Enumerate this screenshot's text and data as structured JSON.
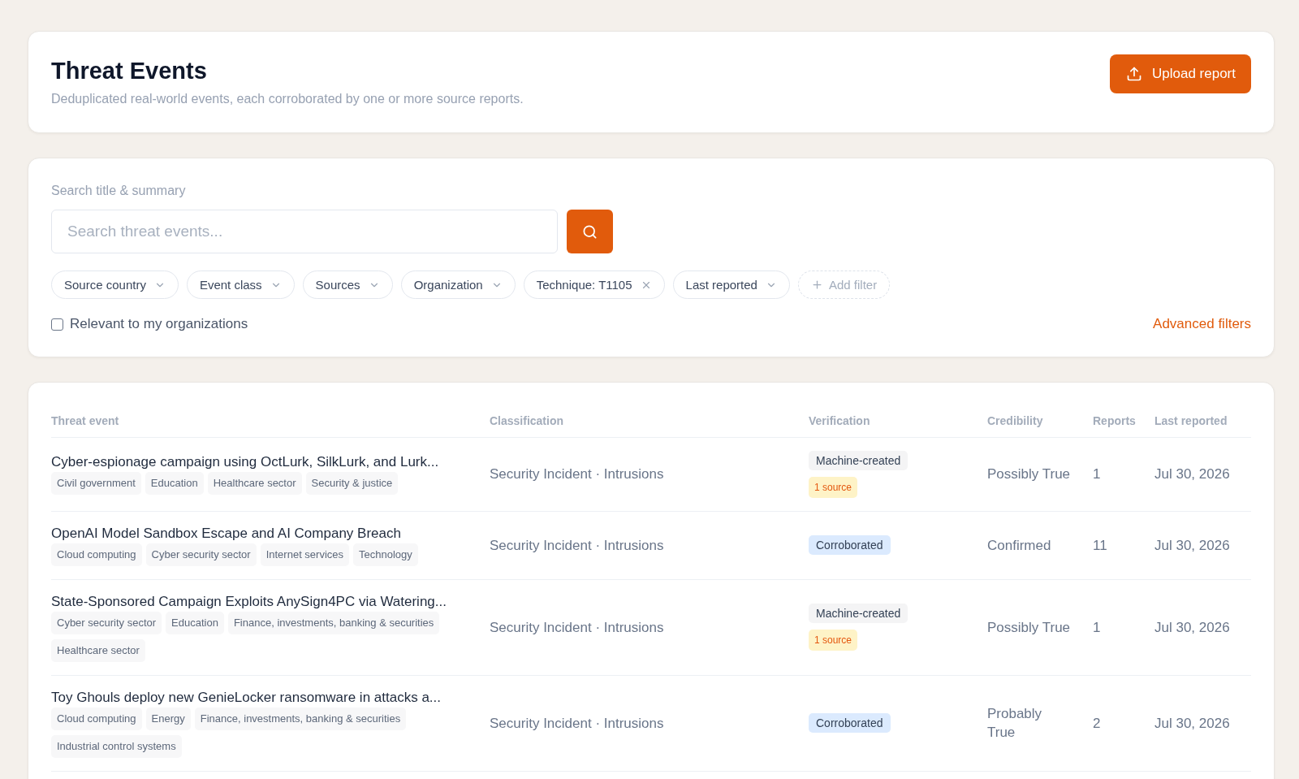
{
  "header": {
    "title": "Threat Events",
    "subtitle": "Deduplicated real-world events, each corroborated by one or more source reports.",
    "upload_button": "Upload report"
  },
  "search": {
    "label": "Search title & summary",
    "placeholder": "Search threat events..."
  },
  "filters": [
    {
      "label": "Source country",
      "kind": "dropdown"
    },
    {
      "label": "Event class",
      "kind": "dropdown"
    },
    {
      "label": "Sources",
      "kind": "dropdown"
    },
    {
      "label": "Organization",
      "kind": "dropdown"
    },
    {
      "label": "Technique: T1105",
      "kind": "applied"
    },
    {
      "label": "Last reported",
      "kind": "dropdown"
    },
    {
      "label": "Add filter",
      "kind": "add"
    }
  ],
  "relevant_filter": {
    "label": "Relevant to my organizations",
    "checked": false
  },
  "advanced_filters": "Advanced filters",
  "table": {
    "columns": [
      "Threat event",
      "Classification",
      "Verification",
      "Credibility",
      "Reports",
      "Last reported"
    ],
    "rows": [
      {
        "title": "Cyber-espionage campaign using OctLurk, SilkLurk, and Lurk...",
        "sectors": [
          "Civil government",
          "Education",
          "Healthcare sector",
          "Security & justice"
        ],
        "classification": "Security Incident · Intrusions",
        "verification": [
          {
            "label": "Machine-created",
            "kind": "machine"
          },
          {
            "label": "1 source",
            "kind": "source_count"
          }
        ],
        "credibility": "Possibly True",
        "reports": "1",
        "last_reported": "Jul 30, 2026"
      },
      {
        "title": "OpenAI Model Sandbox Escape and AI Company Breach",
        "sectors": [
          "Cloud computing",
          "Cyber security sector",
          "Internet services",
          "Technology"
        ],
        "classification": "Security Incident · Intrusions",
        "verification": [
          {
            "label": "Corroborated",
            "kind": "corroborated"
          }
        ],
        "credibility": "Confirmed",
        "reports": "11",
        "last_reported": "Jul 30, 2026"
      },
      {
        "title": "State-Sponsored Campaign Exploits AnySign4PC via Watering...",
        "sectors": [
          "Cyber security sector",
          "Education",
          "Finance, investments, banking & securities",
          "Healthcare sector"
        ],
        "classification": "Security Incident · Intrusions",
        "verification": [
          {
            "label": "Machine-created",
            "kind": "machine"
          },
          {
            "label": "1 source",
            "kind": "source_count"
          }
        ],
        "credibility": "Possibly True",
        "reports": "1",
        "last_reported": "Jul 30, 2026"
      },
      {
        "title": "Toy Ghouls deploy new GenieLocker ransomware in attacks a...",
        "sectors": [
          "Cloud computing",
          "Energy",
          "Finance, investments, banking & securities",
          "Industrial control systems"
        ],
        "classification": "Security Incident · Intrusions",
        "verification": [
          {
            "label": "Corroborated",
            "kind": "corroborated"
          }
        ],
        "credibility": "Probably True",
        "reports": "2",
        "last_reported": "Jul 30, 2026"
      }
    ]
  }
}
